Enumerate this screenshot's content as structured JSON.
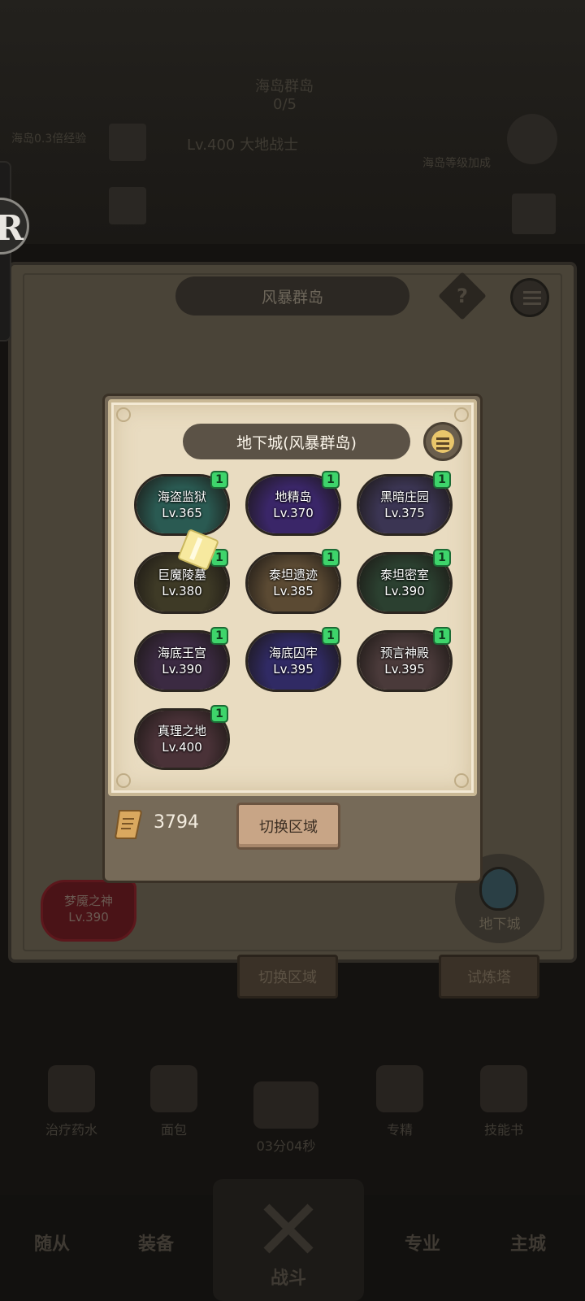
{
  "background": {
    "top_title": "海岛群岛",
    "top_counter": "0/5",
    "top_level_text": "Lv.400 大地战士",
    "left_info": "海岛0.3倍经验",
    "right_info": "海岛等级加成",
    "region_name": "风暴群岛",
    "help_symbol": "?",
    "boss_name": "梦魇之神",
    "boss_level": "Lv.390",
    "dungeon_button": "地下城",
    "switch_button": "切换区域",
    "tower_button": "试炼塔",
    "bottom_items": [
      "治疗药水",
      "面包",
      "03分04秒",
      "专精",
      "技能书"
    ],
    "nav": {
      "left1": "随从",
      "left2": "装备",
      "battle": "战斗",
      "right1": "专业",
      "right2": "主城"
    },
    "float_ball_letter": "R"
  },
  "dialog": {
    "title": "地下城(风暴群岛)",
    "dungeons": [
      {
        "name": "海盗监狱",
        "level": "Lv.365",
        "badge": "1",
        "color": "#2a5a52"
      },
      {
        "name": "地精岛",
        "level": "Lv.370",
        "badge": "1",
        "color": "#3a2668"
      },
      {
        "name": "黑暗庄园",
        "level": "Lv.375",
        "badge": "1",
        "color": "#3b3553"
      },
      {
        "name": "巨魔陵墓",
        "level": "Lv.380",
        "badge": "1",
        "color": "#3e3a26"
      },
      {
        "name": "泰坦遗迹",
        "level": "Lv.385",
        "badge": "1",
        "color": "#5b4a33"
      },
      {
        "name": "泰坦密室",
        "level": "Lv.390",
        "badge": "1",
        "color": "#2b4030"
      },
      {
        "name": "海底王宫",
        "level": "Lv.390",
        "badge": "1",
        "color": "#3b2a42"
      },
      {
        "name": "海底囚牢",
        "level": "Lv.395",
        "badge": "1",
        "color": "#302a64"
      },
      {
        "name": "预言神殿",
        "level": "Lv.395",
        "badge": "1",
        "color": "#4a3a3a"
      },
      {
        "name": "真理之地",
        "level": "Lv.400",
        "badge": "1",
        "color": "#4a3238"
      }
    ],
    "currency_value": "3794",
    "switch_button": "切换区域"
  }
}
